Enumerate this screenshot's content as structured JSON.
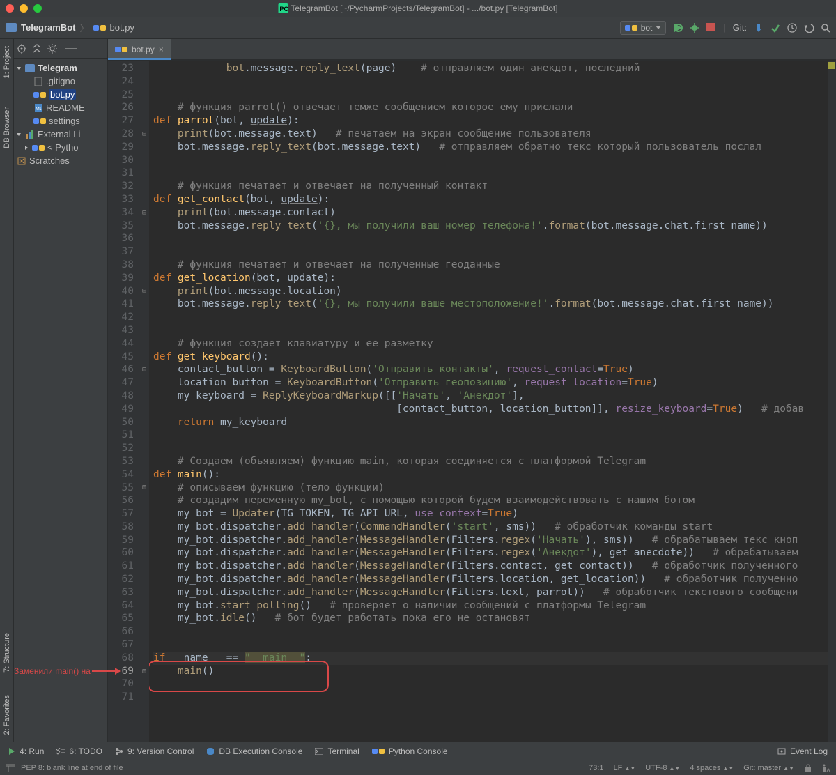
{
  "window": {
    "title": "TelegramBot [~/PycharmProjects/TelegramBot] - .../bot.py [TelegramBot]"
  },
  "breadcrumb": {
    "project": "TelegramBot",
    "file": "bot.py"
  },
  "run_config": {
    "name": "bot"
  },
  "git_label": "Git:",
  "left_gutter": {
    "project": "1: Project",
    "db": "DB Browser",
    "structure": "7: Structure",
    "favorites": "2: Favorites"
  },
  "project_tree": {
    "root": "Telegram",
    "gitignore": ".gitigno",
    "botpy": "bot.py",
    "readme": "README",
    "settings": "settings",
    "ext": "External Li",
    "py": "< Pytho",
    "scratch": "Scratches"
  },
  "tabs": {
    "active": "bot.py"
  },
  "line_start": 23,
  "line_end": 71,
  "cur_line": 69,
  "fold_lines": [
    28,
    34,
    40,
    46,
    55,
    69
  ],
  "code": [
    {
      "segs": [
        {
          "c": "call",
          "t": "            bot"
        },
        {
          "t": ".message."
        },
        {
          "c": "call",
          "t": "reply_text"
        },
        {
          "t": "(page)    "
        },
        {
          "c": "cmt",
          "t": "# отправляем один анекдот, последний"
        }
      ]
    },
    {
      "segs": []
    },
    {
      "segs": []
    },
    {
      "segs": [
        {
          "c": "cmt",
          "t": "    # функция parrot() отвечает темже сообщением которое ему прислали"
        }
      ]
    },
    {
      "segs": [
        {
          "c": "kw",
          "t": "def "
        },
        {
          "c": "fn",
          "t": "parrot"
        },
        {
          "t": "(bot, "
        },
        {
          "c": "prm und",
          "t": "update"
        },
        {
          "t": "):"
        }
      ]
    },
    {
      "segs": [
        {
          "t": "    "
        },
        {
          "c": "call",
          "t": "print"
        },
        {
          "t": "(bot.message.text)   "
        },
        {
          "c": "cmt",
          "t": "# печатаем на экран сообщение пользователя"
        }
      ]
    },
    {
      "segs": [
        {
          "t": "    bot.message."
        },
        {
          "c": "call",
          "t": "reply_text"
        },
        {
          "t": "(bot.message.text)   "
        },
        {
          "c": "cmt",
          "t": "# отправляем обратно текс который пользователь послал"
        }
      ]
    },
    {
      "segs": []
    },
    {
      "segs": []
    },
    {
      "segs": [
        {
          "c": "cmt",
          "t": "    # функция печатает и отвечает на полученный контакт"
        }
      ]
    },
    {
      "segs": [
        {
          "c": "kw",
          "t": "def "
        },
        {
          "c": "fn",
          "t": "get_contact"
        },
        {
          "t": "(bot, "
        },
        {
          "c": "prm und",
          "t": "update"
        },
        {
          "t": "):"
        }
      ]
    },
    {
      "segs": [
        {
          "t": "    "
        },
        {
          "c": "call",
          "t": "print"
        },
        {
          "t": "(bot.message.contact)"
        }
      ]
    },
    {
      "segs": [
        {
          "t": "    bot.message."
        },
        {
          "c": "call",
          "t": "reply_text"
        },
        {
          "t": "("
        },
        {
          "c": "str",
          "t": "'{}, мы получили ваш номер телефона!'"
        },
        {
          "t": "."
        },
        {
          "c": "call",
          "t": "format"
        },
        {
          "t": "(bot.message.chat.first_name))"
        }
      ]
    },
    {
      "segs": []
    },
    {
      "segs": []
    },
    {
      "segs": [
        {
          "c": "cmt",
          "t": "    # функция печатает и отвечает на полученные геоданные"
        }
      ]
    },
    {
      "segs": [
        {
          "c": "kw",
          "t": "def "
        },
        {
          "c": "fn",
          "t": "get_location"
        },
        {
          "t": "(bot, "
        },
        {
          "c": "prm und",
          "t": "update"
        },
        {
          "t": "):"
        }
      ]
    },
    {
      "segs": [
        {
          "t": "    "
        },
        {
          "c": "call",
          "t": "print"
        },
        {
          "t": "(bot.message.location)"
        }
      ]
    },
    {
      "segs": [
        {
          "t": "    bot.message."
        },
        {
          "c": "call",
          "t": "reply_text"
        },
        {
          "t": "("
        },
        {
          "c": "str",
          "t": "'{}, мы получили ваше местоположение!'"
        },
        {
          "t": "."
        },
        {
          "c": "call",
          "t": "format"
        },
        {
          "t": "(bot.message.chat.first_name))"
        }
      ]
    },
    {
      "segs": []
    },
    {
      "segs": []
    },
    {
      "segs": [
        {
          "c": "cmt",
          "t": "    # функция создает клавиатуру и ее разметку"
        }
      ]
    },
    {
      "segs": [
        {
          "c": "kw",
          "t": "def "
        },
        {
          "c": "fn",
          "t": "get_keyboard"
        },
        {
          "t": "():"
        }
      ]
    },
    {
      "segs": [
        {
          "t": "    contact_button = "
        },
        {
          "c": "call",
          "t": "KeyboardButton"
        },
        {
          "t": "("
        },
        {
          "c": "str",
          "t": "'Отправить контакты'"
        },
        {
          "t": ", "
        },
        {
          "c": "attr",
          "t": "request_contact"
        },
        {
          "t": "="
        },
        {
          "c": "bool",
          "t": "True"
        },
        {
          "t": ")"
        }
      ]
    },
    {
      "segs": [
        {
          "t": "    location_button = "
        },
        {
          "c": "call",
          "t": "KeyboardButton"
        },
        {
          "t": "("
        },
        {
          "c": "str",
          "t": "'Отправить геопозицию'"
        },
        {
          "t": ", "
        },
        {
          "c": "attr",
          "t": "request_location"
        },
        {
          "t": "="
        },
        {
          "c": "bool",
          "t": "True"
        },
        {
          "t": ")"
        }
      ]
    },
    {
      "segs": [
        {
          "t": "    my_keyboard = "
        },
        {
          "c": "call",
          "t": "ReplyKeyboardMarkup"
        },
        {
          "t": "([["
        },
        {
          "c": "str",
          "t": "'Начать'"
        },
        {
          "t": ", "
        },
        {
          "c": "str",
          "t": "'Анекдот'"
        },
        {
          "t": "],"
        }
      ]
    },
    {
      "segs": [
        {
          "t": "                                        [contact_button, location_button]], "
        },
        {
          "c": "attr",
          "t": "resize_keyboard"
        },
        {
          "t": "="
        },
        {
          "c": "bool",
          "t": "True"
        },
        {
          "t": ")   "
        },
        {
          "c": "cmt",
          "t": "# добав"
        }
      ]
    },
    {
      "segs": [
        {
          "t": "    "
        },
        {
          "c": "kw",
          "t": "return "
        },
        {
          "t": "my_keyboard"
        }
      ]
    },
    {
      "segs": []
    },
    {
      "segs": []
    },
    {
      "segs": [
        {
          "c": "cmt",
          "t": "    # Создаем (объявляем) функцию main, которая соединяется с платформой Telegram"
        }
      ]
    },
    {
      "segs": [
        {
          "c": "kw",
          "t": "def "
        },
        {
          "c": "fn",
          "t": "main"
        },
        {
          "t": "():"
        }
      ]
    },
    {
      "segs": [
        {
          "c": "cmt",
          "t": "    # описываем функцию (тело функции)"
        }
      ]
    },
    {
      "segs": [
        {
          "c": "cmt",
          "t": "    # создадим переменную my_bot, с помощью которой будем взаимодействовать с нашим ботом"
        }
      ]
    },
    {
      "segs": [
        {
          "t": "    my_bot = "
        },
        {
          "c": "call",
          "t": "Updater"
        },
        {
          "t": "(TG_TOKEN, TG_API_URL, "
        },
        {
          "c": "attr",
          "t": "use_context"
        },
        {
          "t": "="
        },
        {
          "c": "bool",
          "t": "True"
        },
        {
          "t": ")"
        }
      ]
    },
    {
      "segs": [
        {
          "t": "    my_bot.dispatcher."
        },
        {
          "c": "call",
          "t": "add_handler"
        },
        {
          "t": "("
        },
        {
          "c": "call",
          "t": "CommandHandler"
        },
        {
          "t": "("
        },
        {
          "c": "str",
          "t": "'start'"
        },
        {
          "t": ", sms))   "
        },
        {
          "c": "cmt",
          "t": "# обработчик команды start"
        }
      ]
    },
    {
      "segs": [
        {
          "t": "    my_bot.dispatcher."
        },
        {
          "c": "call",
          "t": "add_handler"
        },
        {
          "t": "("
        },
        {
          "c": "call",
          "t": "MessageHandler"
        },
        {
          "t": "(Filters."
        },
        {
          "c": "call",
          "t": "regex"
        },
        {
          "t": "("
        },
        {
          "c": "str",
          "t": "'Начать'"
        },
        {
          "t": "), sms))   "
        },
        {
          "c": "cmt",
          "t": "# обрабатываем текс кноп"
        }
      ]
    },
    {
      "segs": [
        {
          "t": "    my_bot.dispatcher."
        },
        {
          "c": "call",
          "t": "add_handler"
        },
        {
          "t": "("
        },
        {
          "c": "call",
          "t": "MessageHandler"
        },
        {
          "t": "(Filters."
        },
        {
          "c": "call",
          "t": "regex"
        },
        {
          "t": "("
        },
        {
          "c": "str",
          "t": "'Анекдот'"
        },
        {
          "t": "), get_anecdote))   "
        },
        {
          "c": "cmt",
          "t": "# обрабатываем"
        }
      ]
    },
    {
      "segs": [
        {
          "t": "    my_bot.dispatcher."
        },
        {
          "c": "call",
          "t": "add_handler"
        },
        {
          "t": "("
        },
        {
          "c": "call",
          "t": "MessageHandler"
        },
        {
          "t": "(Filters.contact, get_contact))   "
        },
        {
          "c": "cmt",
          "t": "# обработчик полученного"
        }
      ]
    },
    {
      "segs": [
        {
          "t": "    my_bot.dispatcher."
        },
        {
          "c": "call",
          "t": "add_handler"
        },
        {
          "t": "("
        },
        {
          "c": "call",
          "t": "MessageHandler"
        },
        {
          "t": "(Filters.location, get_location))   "
        },
        {
          "c": "cmt",
          "t": "# обработчик полученно"
        }
      ]
    },
    {
      "segs": [
        {
          "t": "    my_bot.dispatcher."
        },
        {
          "c": "call",
          "t": "add_handler"
        },
        {
          "t": "("
        },
        {
          "c": "call",
          "t": "MessageHandler"
        },
        {
          "t": "(Filters.text, parrot))   "
        },
        {
          "c": "cmt",
          "t": "# обработчик текстового сообщени"
        }
      ]
    },
    {
      "segs": [
        {
          "t": "    my_bot."
        },
        {
          "c": "call",
          "t": "start_polling"
        },
        {
          "t": "()   "
        },
        {
          "c": "cmt",
          "t": "# проверяет о наличии сообщений с платформы Telegram"
        }
      ]
    },
    {
      "segs": [
        {
          "t": "    my_bot."
        },
        {
          "c": "call",
          "t": "idle"
        },
        {
          "t": "()   "
        },
        {
          "c": "cmt",
          "t": "# бот будет работать пока его не остановят"
        }
      ]
    },
    {
      "segs": []
    },
    {
      "segs": []
    },
    {
      "segs": [
        {
          "c": "kw",
          "t": "if "
        },
        {
          "t": "__name__ == "
        },
        {
          "c": "str warn-bg",
          "t": "\"__main__\""
        },
        {
          "t": ":"
        }
      ],
      "cur": true
    },
    {
      "segs": [
        {
          "t": "    "
        },
        {
          "c": "call",
          "t": "main"
        },
        {
          "t": "()"
        }
      ]
    },
    {
      "segs": []
    }
  ],
  "annotation": {
    "text": "Заменили main() на"
  },
  "bottom": {
    "run": "4: Run",
    "todo": "6: TODO",
    "vc": "9: Version Control",
    "db": "DB Execution Console",
    "term": "Terminal",
    "pyc": "Python Console",
    "event": "Event Log"
  },
  "status": {
    "msg": "PEP 8: blank line at end of file",
    "pos": "73:1",
    "sep": "LF",
    "enc": "UTF-8",
    "indent": "4 spaces",
    "branch": "Git: master"
  }
}
